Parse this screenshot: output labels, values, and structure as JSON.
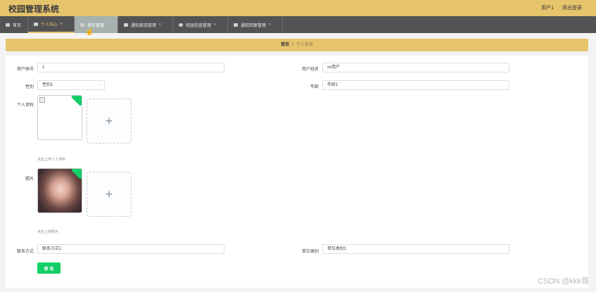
{
  "app": {
    "title": "校园管理系统"
  },
  "top_right": {
    "user": "用户1",
    "logout": "退出登录"
  },
  "nav": {
    "items": [
      {
        "label": "首页"
      },
      {
        "label": "个人中心"
      },
      {
        "label": "单位管理"
      },
      {
        "label": "通知接送管理"
      },
      {
        "label": "校园信息管理"
      },
      {
        "label": "通知回复管理"
      }
    ]
  },
  "breadcrumb": {
    "home": "首页",
    "separator": "/",
    "current": "个人信息"
  },
  "form": {
    "account": {
      "label": "用户账号",
      "value": "1"
    },
    "name": {
      "label": "用户姓名",
      "value": "xx用户"
    },
    "gender": {
      "label": "性别",
      "value": "性别1"
    },
    "age": {
      "label": "年龄",
      "value": "年龄1"
    },
    "profile": {
      "label": "个人资料",
      "hint": "点击上传个人资料"
    },
    "photo": {
      "label": "照片",
      "hint": "点击上传照片"
    },
    "contact": {
      "label": "联系方式",
      "value": "联系方式1"
    },
    "unit_type": {
      "label": "单位类别",
      "value": "单位类别1"
    },
    "submit_label": "修 改"
  },
  "upload_plus": "+",
  "watermark": "CSDN @kkk哥",
  "colors": {
    "accent": "#e6c46c",
    "nav_bg": "#545353",
    "success": "#13ce66"
  }
}
